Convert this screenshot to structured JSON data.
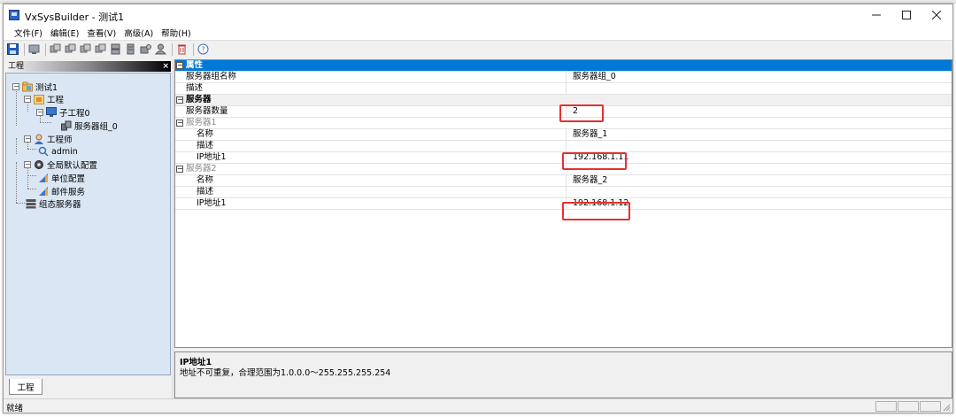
{
  "window": {
    "title": "VxSysBuilder - 测试1"
  },
  "menu": [
    {
      "label": "文件(F)"
    },
    {
      "label": "编辑(E)"
    },
    {
      "label": "查看(V)"
    },
    {
      "label": "高级(A)"
    },
    {
      "label": "帮助(H)"
    }
  ],
  "toolbar": {
    "icons": [
      "save-icon",
      "project-icon",
      "add-icon",
      "add-icon",
      "add-icon",
      "add-icon",
      "server-icon",
      "server-icon",
      "group-icon",
      "user-icon",
      "delete-icon",
      "help-icon"
    ]
  },
  "left_pane": {
    "title": "工程",
    "close_glyph": "×",
    "tab_label": "工程",
    "tree": [
      {
        "label": "测试1",
        "icon": "folder-icon"
      },
      {
        "label": "工程",
        "icon": "project-folder-icon"
      },
      {
        "label": "子工程0",
        "icon": "monitor-icon"
      },
      {
        "label": "服务器组_0",
        "icon": "server-group-icon"
      },
      {
        "label": "工程师",
        "icon": "engineer-icon"
      },
      {
        "label": "admin",
        "icon": "user-icon"
      },
      {
        "label": "全局默认配置",
        "icon": "gear-icon"
      },
      {
        "label": "单位配置",
        "icon": "config-icon"
      },
      {
        "label": "邮件服务",
        "icon": "config-icon"
      },
      {
        "label": "组态服务器",
        "icon": "server-stack-icon"
      }
    ]
  },
  "property_grid": {
    "rows": [
      {
        "name": "属性",
        "value": ""
      },
      {
        "name": "服务器组名称",
        "value": "服务器组_0"
      },
      {
        "name": "描述",
        "value": ""
      },
      {
        "name": "服务器",
        "value": ""
      },
      {
        "name": "服务器数量",
        "value": "2"
      },
      {
        "name": "服务器1",
        "value": ""
      },
      {
        "name": "名称",
        "value": "服务器_1"
      },
      {
        "name": "描述",
        "value": ""
      },
      {
        "name": "IP地址1",
        "value": "192.168.1.11"
      },
      {
        "name": "服务器2",
        "value": ""
      },
      {
        "name": "名称",
        "value": "服务器_2"
      },
      {
        "name": "描述",
        "value": ""
      },
      {
        "name": "IP地址1",
        "value": "192.168.1.12"
      }
    ],
    "expander_glyph": "−"
  },
  "description": {
    "title": "IP地址1",
    "text": "地址不可重复，合理范围为1.0.0.0～255.255.255.254"
  },
  "status": {
    "text": "就绪"
  },
  "colors": {
    "selection": "#0078d7",
    "tree_background": "#dbe6f4",
    "highlight_box": "#e53030"
  }
}
